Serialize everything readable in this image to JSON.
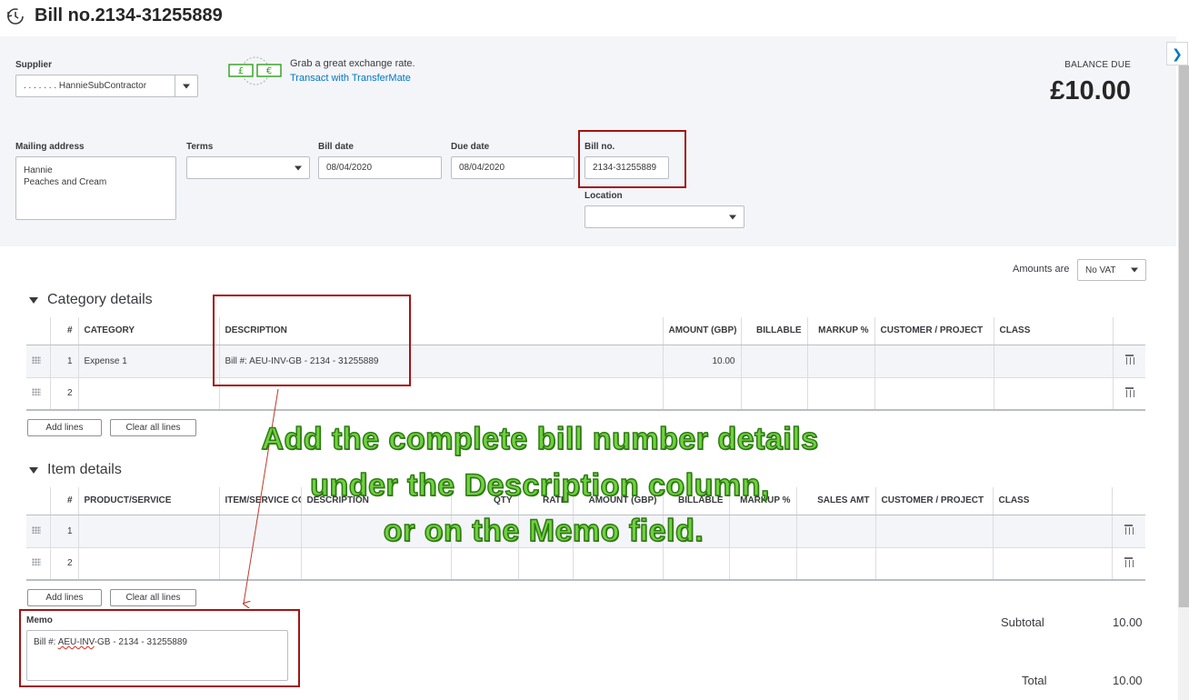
{
  "header": {
    "title": "Bill no.2134-31255889",
    "icon": "history-icon"
  },
  "supplier": {
    "label": "Supplier",
    "value": ". . . . . . . HannieSubContractor"
  },
  "transfer": {
    "line1": "Grab a great exchange rate.",
    "link": "Transact with TransferMate"
  },
  "balance": {
    "label": "BALANCE DUE",
    "value": "£10.00"
  },
  "mailing": {
    "label": "Mailing address",
    "line1": "Hannie",
    "line2": "Peaches and Cream"
  },
  "terms": {
    "label": "Terms",
    "value": ""
  },
  "bill_date": {
    "label": "Bill date",
    "value": "08/04/2020"
  },
  "due_date": {
    "label": "Due date",
    "value": "08/04/2020"
  },
  "bill_no": {
    "label": "Bill no.",
    "value": "2134-31255889"
  },
  "location": {
    "label": "Location",
    "value": ""
  },
  "amounts_are": {
    "label": "Amounts are",
    "value": "No VAT"
  },
  "category": {
    "title": "Category details",
    "headers": [
      "#",
      "CATEGORY",
      "DESCRIPTION",
      "AMOUNT (GBP)",
      "BILLABLE",
      "MARKUP %",
      "CUSTOMER / PROJECT",
      "CLASS"
    ],
    "rows": [
      {
        "num": "1",
        "category": "Expense 1",
        "description": "Bill #:  AEU-INV-GB - 2134 - 31255889",
        "amount": "10.00"
      },
      {
        "num": "2",
        "category": "",
        "description": "",
        "amount": ""
      }
    ],
    "add_lines": "Add lines",
    "clear_lines": "Clear all lines"
  },
  "items": {
    "title": "Item details",
    "headers": [
      "#",
      "PRODUCT/SERVICE",
      "ITEM/SERVICE CODE",
      "DESCRIPTION",
      "QTY",
      "RATE",
      "AMOUNT (GBP)",
      "BILLABLE",
      "MARKUP %",
      "SALES AMT",
      "CUSTOMER / PROJECT",
      "CLASS"
    ],
    "rows": [
      {
        "num": "1"
      },
      {
        "num": "2"
      }
    ],
    "add_lines": "Add lines",
    "clear_lines": "Clear all lines"
  },
  "memo": {
    "label": "Memo",
    "prefix": "Bill #:  ",
    "squiggle": "AEU-INV",
    "suffix": "-GB - 2134 - 31255889"
  },
  "totals": {
    "subtotal_label": "Subtotal",
    "subtotal": "10.00",
    "total_label": "Total",
    "total": "10.00"
  },
  "annotation": {
    "line1": "Add the complete bill number details",
    "line2": "under the Description column,",
    "line3": "or on the Memo field."
  },
  "colors": {
    "highlight_box": "#a31313",
    "annotation_fill": "#6fd13f",
    "annotation_stroke": "#2e7a14",
    "link": "#0077c5"
  }
}
